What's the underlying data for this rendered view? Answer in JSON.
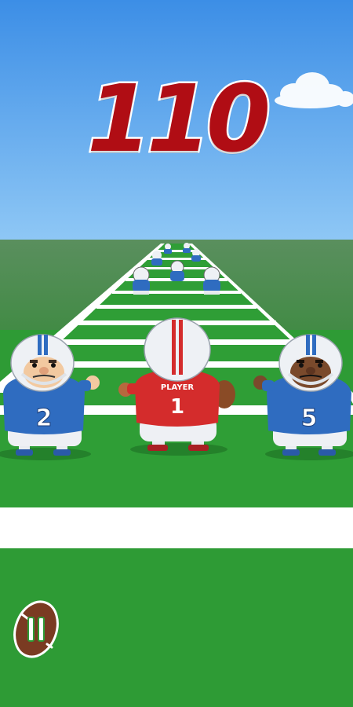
{
  "hud": {
    "score": "110",
    "pause_button": "pause"
  },
  "players": {
    "hero": {
      "label": "PLAYER",
      "number": "1",
      "jersey_color": "#d42c2c"
    },
    "left_defender": {
      "number": "2",
      "jersey_color": "#2f6cc0"
    },
    "right_defender": {
      "number": "5",
      "jersey_color": "#2f6cc0"
    }
  },
  "colors": {
    "sky_top": "#3c8ee6",
    "sky_bottom": "#8ec7f5",
    "field_green": "#2e9b35",
    "field_dark": "#237d2a",
    "score_red": "#b00d14"
  }
}
